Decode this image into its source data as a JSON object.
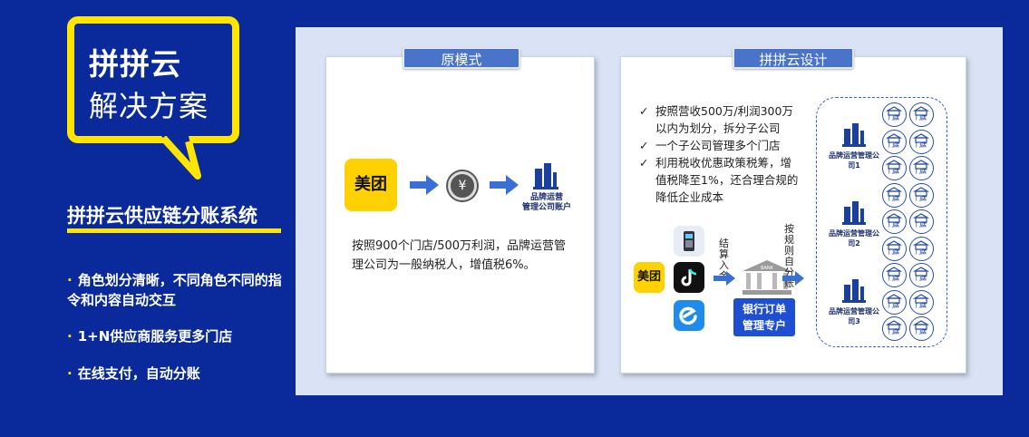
{
  "left": {
    "brand_title": "拼拼云",
    "brand_subtitle": "解决方案",
    "system_title": "拼拼云供应链分账系统",
    "bullets": [
      "角色划分清晰，不同角色不同的指令和内容自动交互",
      "1+N供应商服务更多门店",
      "在线支付，自动分账"
    ]
  },
  "original": {
    "tab_label": "原模式",
    "meituan_label": "美团",
    "coin_glyph": "¥",
    "account_label_line1": "品牌运营",
    "account_label_line2": "管理公司账户",
    "description": "按照900个门店/500万利润，品牌运营管理公司为一般纳税人，增值税6%。"
  },
  "design": {
    "tab_label": "拼拼云设计",
    "checks": [
      "按照营收500万/利润300万以内为划分，拆分子公司",
      "一个子公司管理多个门店",
      "利用税收优惠政策税筹，增值税降至1%，还合理合规的降低企业成本"
    ],
    "meituan_label": "美团",
    "settle_label": "结算入金",
    "split_label": "按规则自分账",
    "bank_label_line1": "银行订单",
    "bank_label_line2": "管理专户",
    "bank_sign": "BANK",
    "sub_companies": [
      "品牌运营管理公司1",
      "品牌运营管理公司2",
      "品牌运营管理公司3"
    ],
    "store_label": "门店"
  },
  "colors": {
    "background": "#0a2a9c",
    "accent_yellow": "#ffe500",
    "tab_blue": "#4a74c9",
    "arrow_blue": "#3a6fd6"
  }
}
